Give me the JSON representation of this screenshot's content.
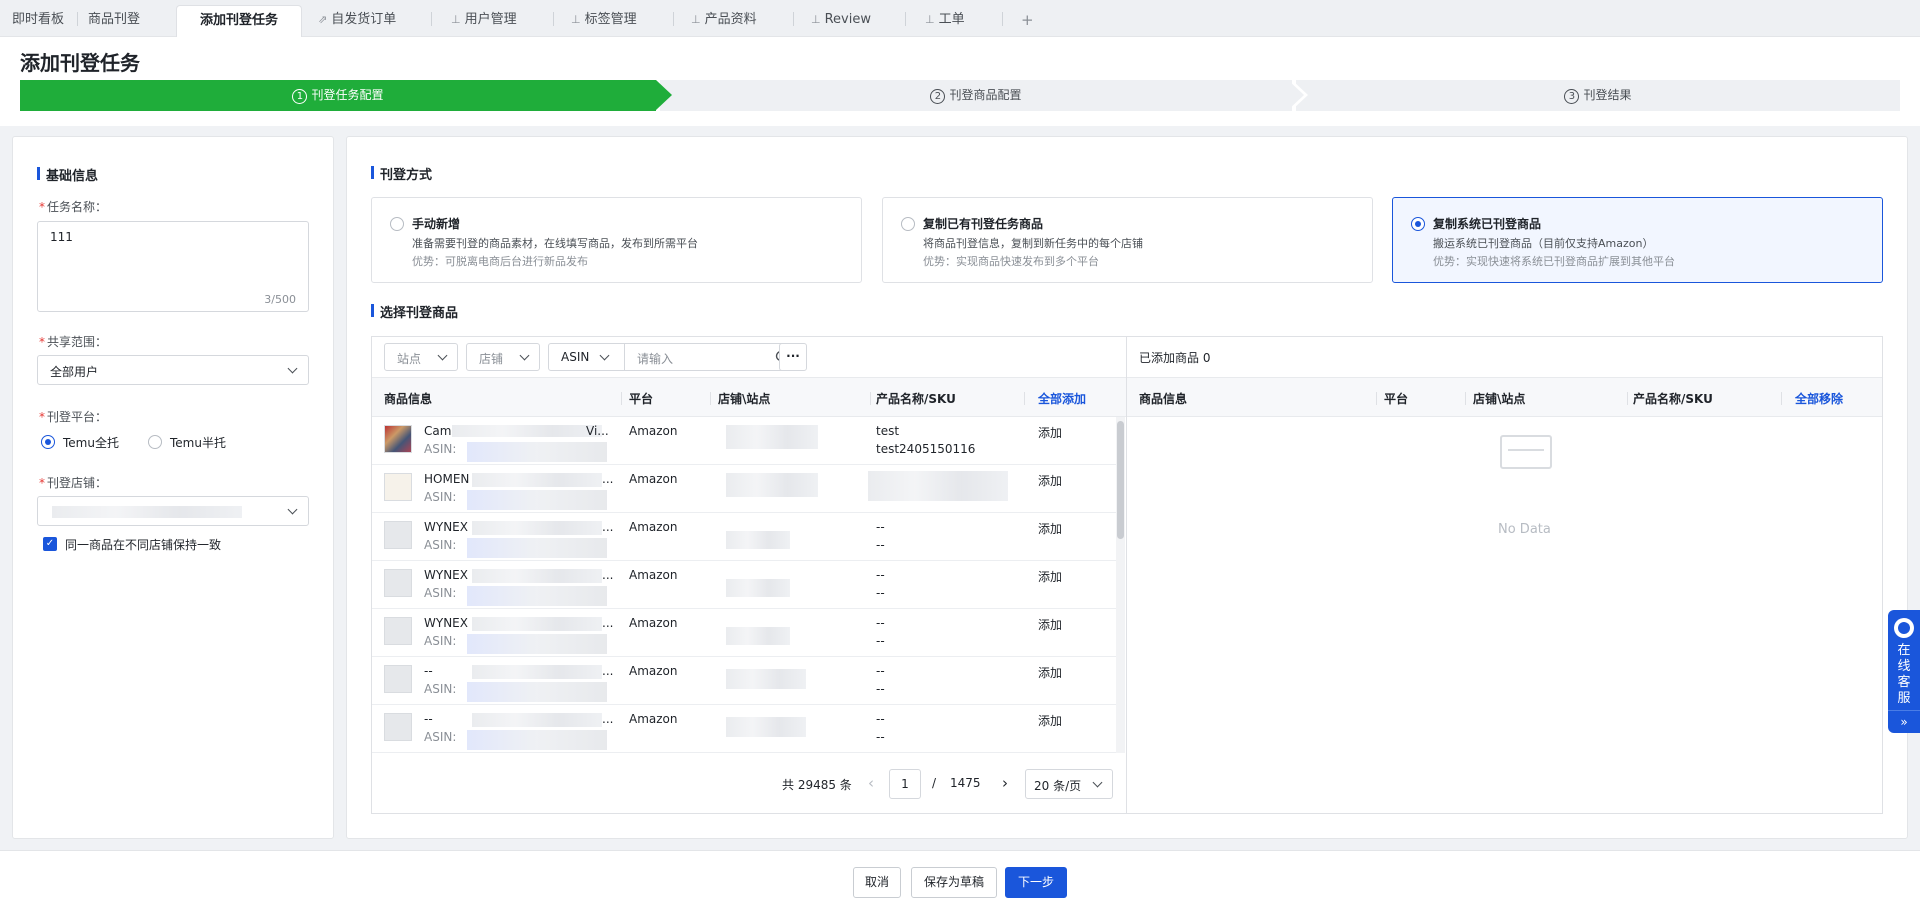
{
  "tabs": [
    {
      "label": "即时看板",
      "pinned": false,
      "active": false
    },
    {
      "label": "商品刊登",
      "pinned": false,
      "active": false
    },
    {
      "label": "添加刊登任务",
      "pinned": false,
      "active": true
    },
    {
      "label": "自发货订单",
      "pinned": true,
      "active": false
    },
    {
      "label": "用户管理",
      "pinned": true,
      "active": false
    },
    {
      "label": "标签管理",
      "pinned": true,
      "active": false
    },
    {
      "label": "产品资料",
      "pinned": true,
      "active": false
    },
    {
      "label": "Review",
      "pinned": true,
      "active": false
    },
    {
      "label": "工单",
      "pinned": true,
      "active": false
    }
  ],
  "add_tab": "+",
  "page_title": "添加刊登任务",
  "steps": [
    {
      "num": "1",
      "label": "刊登任务配置",
      "state": "active"
    },
    {
      "num": "2",
      "label": "刊登商品配置",
      "state": "pending"
    },
    {
      "num": "3",
      "label": "刊登结果",
      "state": "pending"
    }
  ],
  "basic": {
    "title": "基础信息",
    "task_name_label": "任务名称：",
    "task_name_value": "111",
    "task_name_count": "3/500",
    "share_label": "共享范围：",
    "share_value": "全部用户",
    "platform_label": "刊登平台：",
    "platform_options": [
      {
        "label": "Temu全托",
        "selected": true
      },
      {
        "label": "Temu半托",
        "selected": false
      }
    ],
    "store_label": "刊登店铺：",
    "consistent_label": "同一商品在不同店铺保持一致",
    "consistent_checked": true
  },
  "method": {
    "title": "刊登方式",
    "cards": [
      {
        "title": "手动新增",
        "desc": "准备需要刊登的商品素材，在线填写商品，发布到所需平台",
        "adv": "优势：可脱离电商后台进行新品发布",
        "selected": false
      },
      {
        "title": "复制已有刊登任务商品",
        "desc": "将商品刊登信息，复制到新任务中的每个店铺",
        "adv": "优势：实现商品快速发布到多个平台",
        "selected": false
      },
      {
        "title": "复制系统已刊登商品",
        "desc": "搬运系统已刊登商品（目前仅支持Amazon）",
        "adv": "优势：实现快速将系统已刊登商品扩展到其他平台",
        "selected": true
      }
    ]
  },
  "select": {
    "title": "选择刊登商品",
    "filter_site": "站点",
    "filter_store": "店铺",
    "filter_field": "ASIN",
    "search_placeholder": "请输入",
    "more": "···",
    "columns": {
      "info": "商品信息",
      "platform": "平台",
      "store": "店铺\\站点",
      "name": "产品名称/SKU",
      "add_all": "全部添加"
    },
    "rows": [
      {
        "name": "Cam",
        "name_tail": "Vi...",
        "asin_label": "ASIN:",
        "platform": "Amazon",
        "pname": "test",
        "sku": "test2405150116",
        "action": "添加"
      },
      {
        "name": "HOMEN",
        "name_tail": "...",
        "asin_label": "ASIN:",
        "platform": "Amazon",
        "pname": "",
        "sku": "",
        "action": "添加"
      },
      {
        "name": "WYNEX",
        "name_tail": "...",
        "asin_label": "ASIN:",
        "platform": "Amazon",
        "pname": "--",
        "sku": "--",
        "action": "添加"
      },
      {
        "name": "WYNEX",
        "name_tail": "...",
        "asin_label": "ASIN:",
        "platform": "Amazon",
        "pname": "--",
        "sku": "--",
        "action": "添加"
      },
      {
        "name": "WYNEX",
        "name_tail": "...",
        "asin_label": "ASIN:",
        "platform": "Amazon",
        "pname": "--",
        "sku": "--",
        "action": "添加"
      },
      {
        "name": "--",
        "name_tail": "...",
        "asin_label": "ASIN:",
        "platform": "Amazon",
        "pname": "--",
        "sku": "--",
        "action": "添加"
      },
      {
        "name": "--",
        "name_tail": "...",
        "asin_label": "ASIN:",
        "platform": "Amazon",
        "pname": "--",
        "sku": "--",
        "action": "添加"
      }
    ],
    "pager": {
      "total": "共 29485 条",
      "prev": "‹",
      "page": "1",
      "sep": "/",
      "pages": "1475",
      "next": "›",
      "page_size": "20 条/页"
    }
  },
  "added": {
    "count_text": "已添加商品 0",
    "columns": {
      "info": "商品信息",
      "platform": "平台",
      "store": "店铺\\站点",
      "name": "产品名称/SKU",
      "remove_all": "全部移除"
    },
    "empty": "No Data"
  },
  "footer": {
    "cancel": "取消",
    "save": "保存为草稿",
    "next": "下一步"
  },
  "service": {
    "label": "在线客服",
    "more": "»"
  },
  "colors": {
    "primary": "#1a56db",
    "step_active": "#1fad3a",
    "required": "#e53935"
  }
}
